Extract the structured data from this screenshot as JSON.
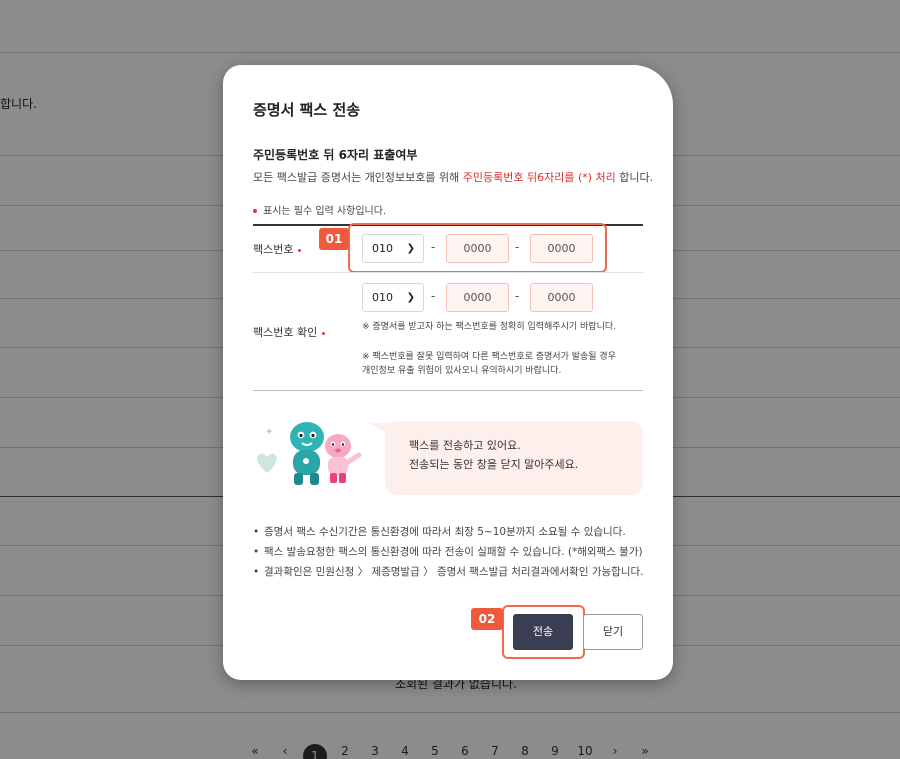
{
  "background": {
    "partial_text_top": "합니다.",
    "partial_text_bottom": "조회된 결과가 없습니다.",
    "pagination": {
      "first": "«",
      "prev": "‹",
      "pages": [
        "1",
        "2",
        "3",
        "4",
        "5",
        "6",
        "7",
        "8",
        "9",
        "10"
      ],
      "next": "›",
      "last": "»"
    }
  },
  "modal": {
    "title": "증명서 팩스 전송",
    "section_title": "주민등록번호 뒤 6자리 표출여부",
    "desc_prefix": "모든 팩스발급 증명서는 개인정보보호를 위해 ",
    "desc_highlight": "주민등록번호 뒤6자리를 (*) 처리",
    "desc_suffix": " 합니다.",
    "required_note": "표시는 필수 입력 사항입니다.",
    "fax_row": {
      "label": "팩스번호",
      "area_code": "010",
      "part2_placeholder": "0000",
      "part3_placeholder": "0000",
      "dash": "-"
    },
    "fax_confirm_row": {
      "label": "팩스번호 확인",
      "area_code": "010",
      "part2_placeholder": "0000",
      "part3_placeholder": "0000",
      "notice_1": "※ 증명서를 받고자 하는 팩스번호를 정확히 입력해주시기 바랍니다.",
      "notice_2": "※ 팩스번호를 잘못 입력하여 다른 팩스번호로 증명서가 발송될 경우 개인정보 유출 위험이 있사오니 유의하시기 바랍니다."
    },
    "bubble": {
      "line1": "팩스를 전송하고 있어요.",
      "line2": "전송되는 동안 창을 닫지 말아주세요."
    },
    "info": [
      "증명서 팩스 수신기간은 통신환경에 따라서 최장 5~10분까지 소요될 수 있습니다.",
      "팩스 발송요청한 팩스의 통신환경에 따라 전송이 실패할 수 있습니다. (*해외팩스 불가)",
      "결과확인은 민원신청 〉 제증명발급 〉 증명서 팩스발급 처리결과에서확인 가능합니다."
    ],
    "buttons": {
      "send": "전송",
      "close": "닫기"
    },
    "badges": {
      "step1": "01",
      "step2": "02"
    }
  },
  "colors": {
    "accent": "#f05a3c",
    "primary_button": "#3a3e52",
    "required": "#e53935",
    "input_bg": "#fff4f1"
  }
}
